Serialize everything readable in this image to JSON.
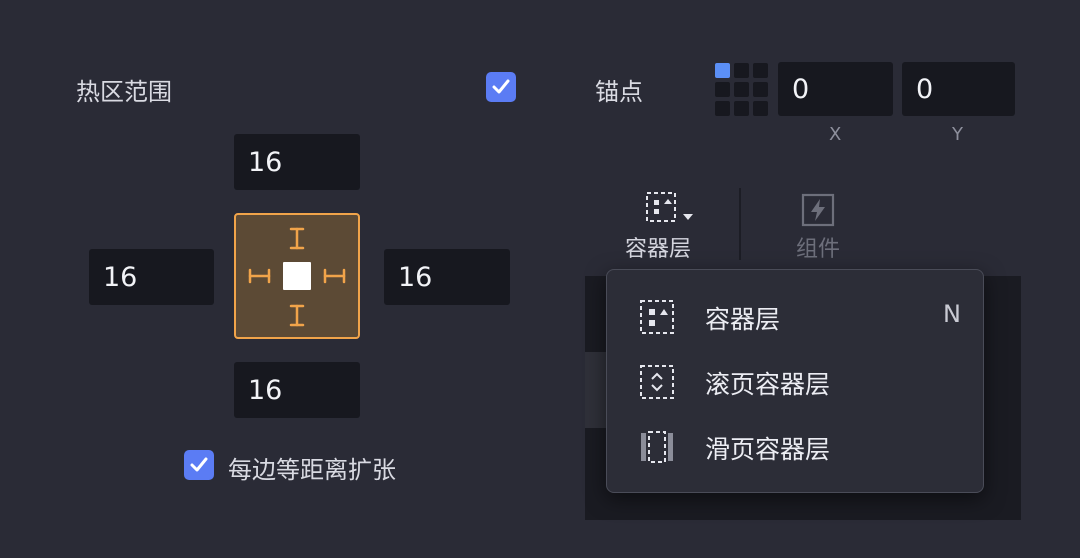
{
  "hotzone": {
    "label": "热区范围",
    "checked": true,
    "top": "16",
    "left": "16",
    "right": "16",
    "bottom": "16"
  },
  "anchor": {
    "label": "锚点",
    "x_value": "0",
    "y_value": "0",
    "x_label": "X",
    "y_label": "Y",
    "selected_cell": "top-left"
  },
  "equal_expand": {
    "label": "每边等距离扩张",
    "checked": true
  },
  "toolbar": {
    "container_layer": "容器层",
    "component": "组件"
  },
  "dropdown": {
    "items": [
      {
        "label": "容器层",
        "shortcut": "N",
        "icon": "container-layer-icon"
      },
      {
        "label": "滚页容器层",
        "shortcut": "",
        "icon": "scroll-container-icon"
      },
      {
        "label": "滑页容器层",
        "shortcut": "",
        "icon": "slide-container-icon"
      }
    ]
  },
  "colors": {
    "background": "#2a2b36",
    "input_bg": "#17181f",
    "accent_blue": "#5b7cf4",
    "accent_orange": "#f1a44a"
  }
}
